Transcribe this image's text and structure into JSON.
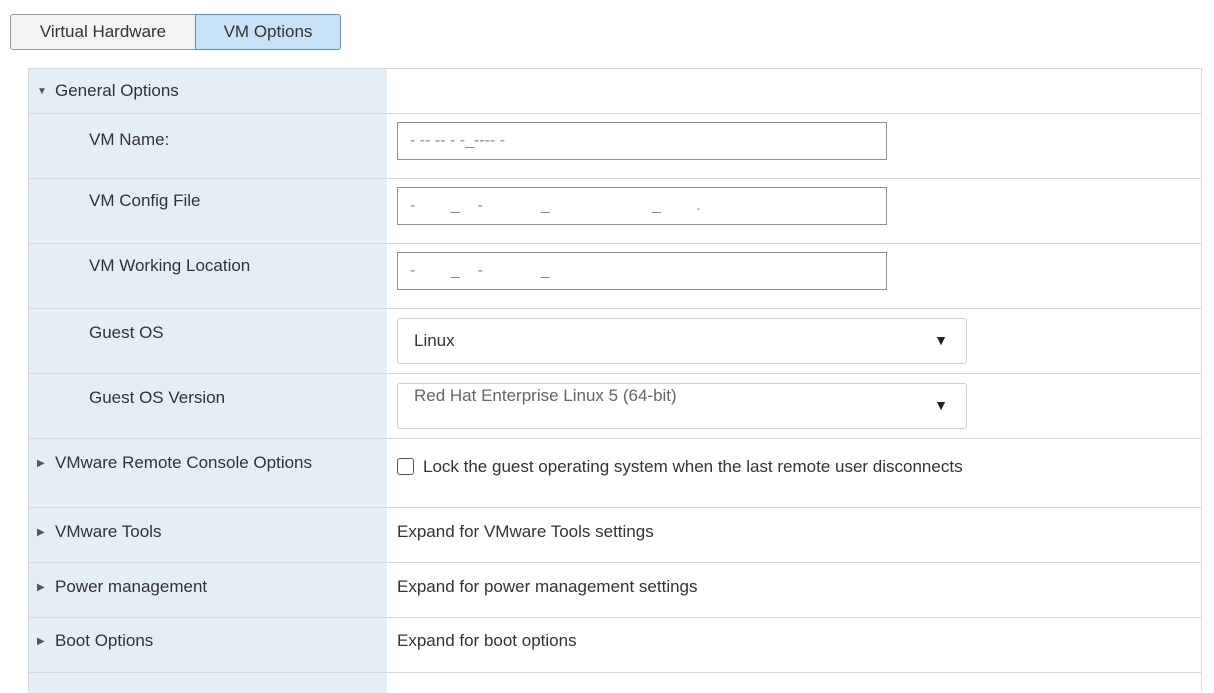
{
  "tabs": [
    {
      "label": "Virtual Hardware",
      "active": false
    },
    {
      "label": "VM Options",
      "active": true
    }
  ],
  "general_options": {
    "label": "General Options",
    "expanded": true,
    "fields": {
      "vm_name": {
        "label": "VM Name:",
        "value": "- -- -- - -_---- -"
      },
      "vm_config_file": {
        "label": "VM Config File",
        "value": "-        _    -             _                       _        ."
      },
      "vm_working_location": {
        "label": "VM Working Location",
        "value": "-        _    -             _"
      },
      "guest_os": {
        "label": "Guest OS",
        "selected": "Linux"
      },
      "guest_os_version": {
        "label": "Guest OS Version",
        "selected": "Red Hat Enterprise Linux 5 (64-bit)"
      }
    }
  },
  "remote_console": {
    "label": "VMware Remote Console Options",
    "checkbox_label": "Lock the guest operating system when the last remote user disconnects",
    "checked": false
  },
  "vmware_tools": {
    "label": "VMware Tools",
    "summary": "Expand for VMware Tools settings"
  },
  "power_management": {
    "label": "Power management",
    "summary": "Expand for power management settings"
  },
  "boot_options": {
    "label": "Boot Options",
    "summary": "Expand for boot options"
  },
  "icons": {
    "expanded": "triangle-down-icon",
    "collapsed": "triangle-right-icon",
    "dropdown": "dropdown-arrow-icon"
  }
}
